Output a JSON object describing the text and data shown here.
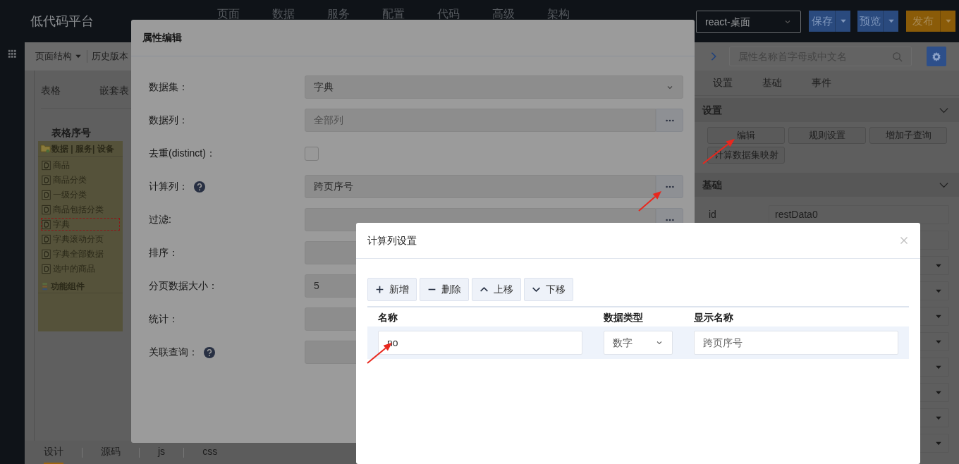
{
  "app": {
    "title": "低代码平台",
    "nav": [
      "页面",
      "数据",
      "服务",
      "配置",
      "代码",
      "高级",
      "架构"
    ],
    "platform_select": "react-桌面",
    "actions": [
      {
        "label": "保存",
        "kind": "primary"
      },
      {
        "label": "预览",
        "kind": "primary"
      },
      {
        "label": "发布",
        "kind": "warning"
      }
    ]
  },
  "toolbar": [
    {
      "label": "页面结构",
      "dropdown": true
    },
    {
      "label": "历史版本",
      "dropdown": false
    }
  ],
  "canvas": {
    "tabs": [
      "表格",
      "嵌套表"
    ],
    "column_header": "表格序号"
  },
  "tree": {
    "header": "数据 | 服务| 设备",
    "items": [
      {
        "label": "商品",
        "selected": false
      },
      {
        "label": "商品分类",
        "selected": false
      },
      {
        "label": "一级分类",
        "selected": false
      },
      {
        "label": "商品包括分类",
        "selected": false
      },
      {
        "label": "字典",
        "selected": true
      },
      {
        "label": "字典滚动分页",
        "selected": false
      },
      {
        "label": "字典全部数据",
        "selected": false
      },
      {
        "label": "选中的商品",
        "selected": false
      }
    ],
    "footer": "功能组件"
  },
  "bottom_tabs": [
    {
      "label": "设计",
      "selected": true
    },
    {
      "label": "源码",
      "selected": false
    },
    {
      "label": "js",
      "selected": false
    },
    {
      "label": "css",
      "selected": false
    }
  ],
  "right_panel": {
    "search_placeholder": "属性名称首字母或中文名",
    "tabs": [
      "设置",
      "基础",
      "事件"
    ],
    "settings_section": {
      "title": "设置",
      "buttons": [
        "编辑",
        "规则设置",
        "增加子查询",
        "计算数据集映射"
      ]
    },
    "basic_section": {
      "title": "基础",
      "fields": [
        {
          "kind": "text",
          "label": "id",
          "value": "restData0"
        },
        {
          "kind": "text"
        },
        {
          "kind": "dropdown"
        },
        {
          "kind": "dropdown"
        },
        {
          "kind": "dropdown"
        },
        {
          "kind": "dropdown"
        },
        {
          "kind": "dropdown"
        },
        {
          "kind": "dropdown"
        },
        {
          "kind": "dropdown"
        },
        {
          "kind": "dropdown"
        }
      ]
    }
  },
  "property_dialog": {
    "title": "属性编辑",
    "fields": [
      {
        "label": "数据集：",
        "kind": "select",
        "value": "字典",
        "help": false
      },
      {
        "label": "数据列：",
        "kind": "picker",
        "placeholder": "全部列",
        "help": false
      },
      {
        "label": "去重(distinct)：",
        "kind": "checkbox",
        "checked": false,
        "help": false
      },
      {
        "label": "计算列：",
        "kind": "picker",
        "value": "跨页序号",
        "help": true
      },
      {
        "label": "过滤:",
        "kind": "picker",
        "help": false
      },
      {
        "label": "排序：",
        "kind": "text",
        "help": false
      },
      {
        "label": "分页数据大小：",
        "kind": "text",
        "value": "5",
        "help": false
      },
      {
        "label": "统计：",
        "kind": "text",
        "help": false
      },
      {
        "label": "关联查询：",
        "kind": "text",
        "help": true
      }
    ]
  },
  "calc_dialog": {
    "title": "计算列设置",
    "toolbar": [
      {
        "label": "新增",
        "kind": "plus"
      },
      {
        "label": "删除",
        "kind": "minus"
      },
      {
        "label": "上移",
        "kind": "up"
      },
      {
        "label": "下移",
        "kind": "down"
      }
    ],
    "columns": [
      "名称",
      "数据类型",
      "显示名称"
    ],
    "rows": [
      {
        "name": "no",
        "type": "数字",
        "display": "跨页序号"
      }
    ]
  }
}
